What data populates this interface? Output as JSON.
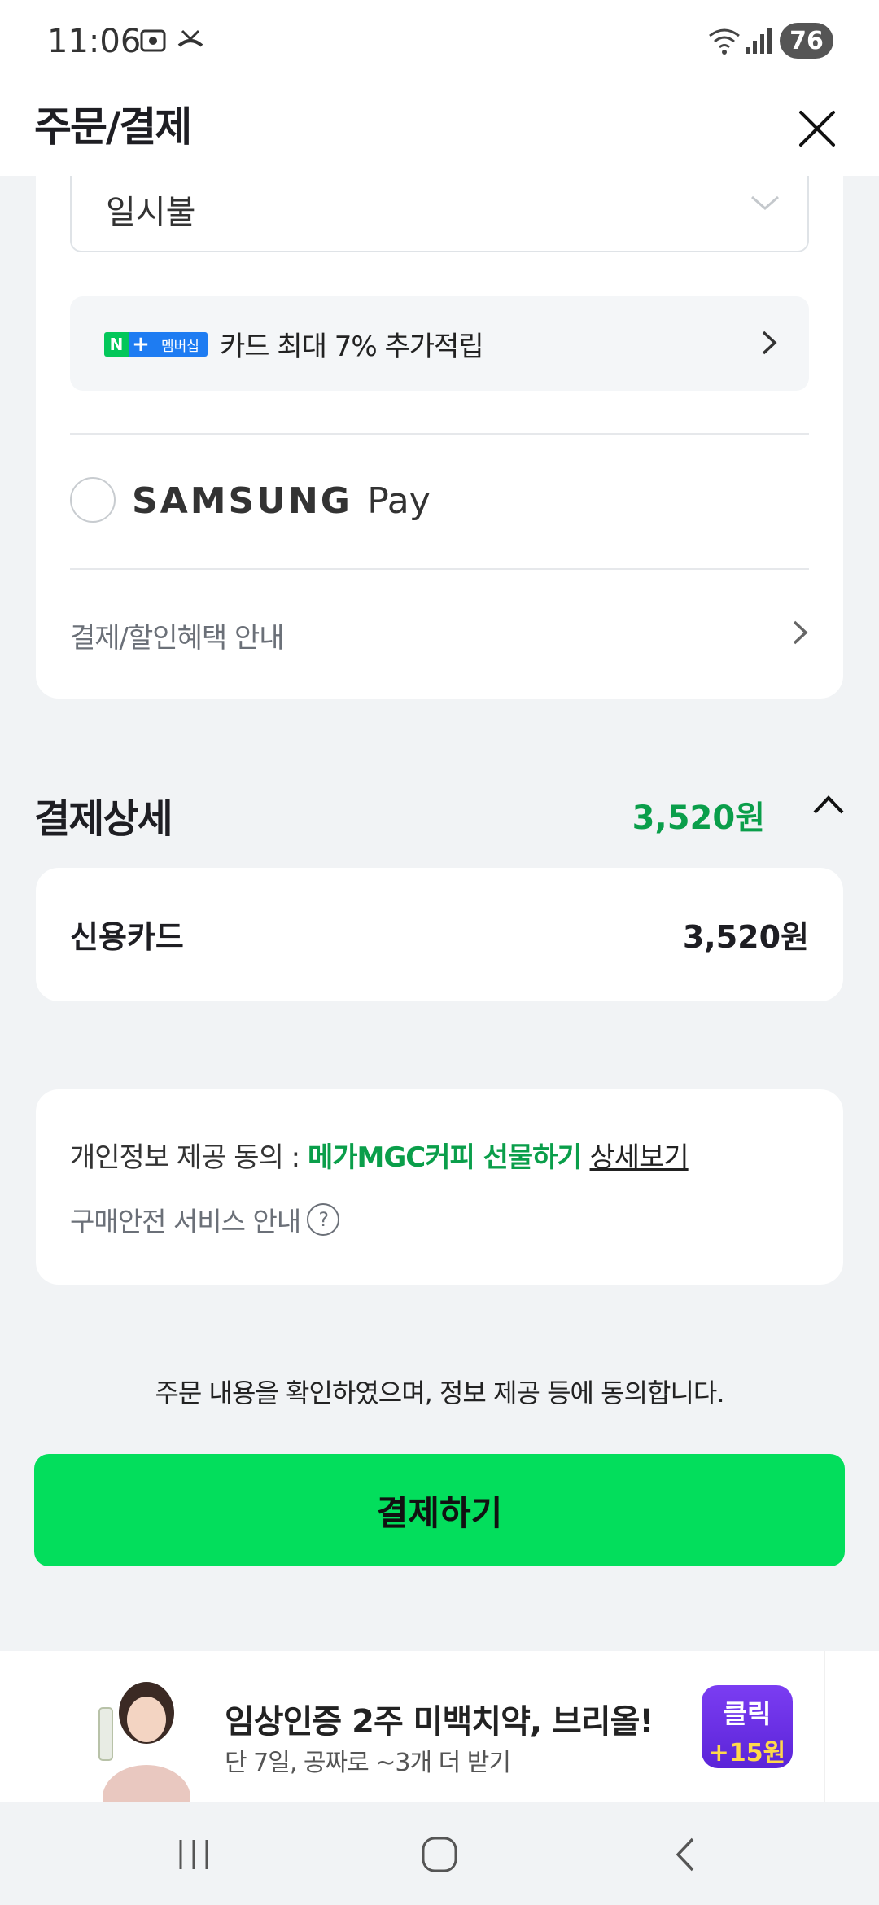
{
  "status_bar": {
    "time": "11:06",
    "battery": "76",
    "left_icons": [
      "screenshot-icon",
      "missed-call-icon"
    ],
    "right_icons": [
      "wifi-icon",
      "signal-icon"
    ]
  },
  "header": {
    "title": "주문/결제",
    "close_icon": "close-icon"
  },
  "payment_method": {
    "installment_value": "일시불",
    "benefit": {
      "badge_n": "N",
      "badge_plus": "+",
      "badge_label": "멤버십",
      "text": "카드 최대 7% 추가적립"
    },
    "samsung_pay_label": "SAMSUNG",
    "samsung_pay_suffix": "Pay",
    "info_link": "결제/할인혜택 안내"
  },
  "payment_detail": {
    "title": "결제상세",
    "total": "3,520원",
    "method": "신용카드",
    "amount": "3,520원"
  },
  "consent": {
    "prefix": "개인정보 제공 동의 : ",
    "service": "메가MGC커피 선물하기",
    "detail_link": "상세보기",
    "safety": "구매안전 서비스 안내",
    "help_symbol": "?"
  },
  "confirm_text": "주문 내용을 확인하였으며, 정보 제공 등에 동의합니다.",
  "pay_button": "결제하기",
  "ad": {
    "title": "임상인증 2주 미백치약, 브리올!",
    "subtitle": "단 7일, 공짜로 ~3개 더 받기",
    "reward_line1": "클릭",
    "reward_line2": "+15원"
  },
  "colors": {
    "accent_green": "#03de5c",
    "price_green": "#0a9e4a",
    "background": "#f1f3f5"
  }
}
